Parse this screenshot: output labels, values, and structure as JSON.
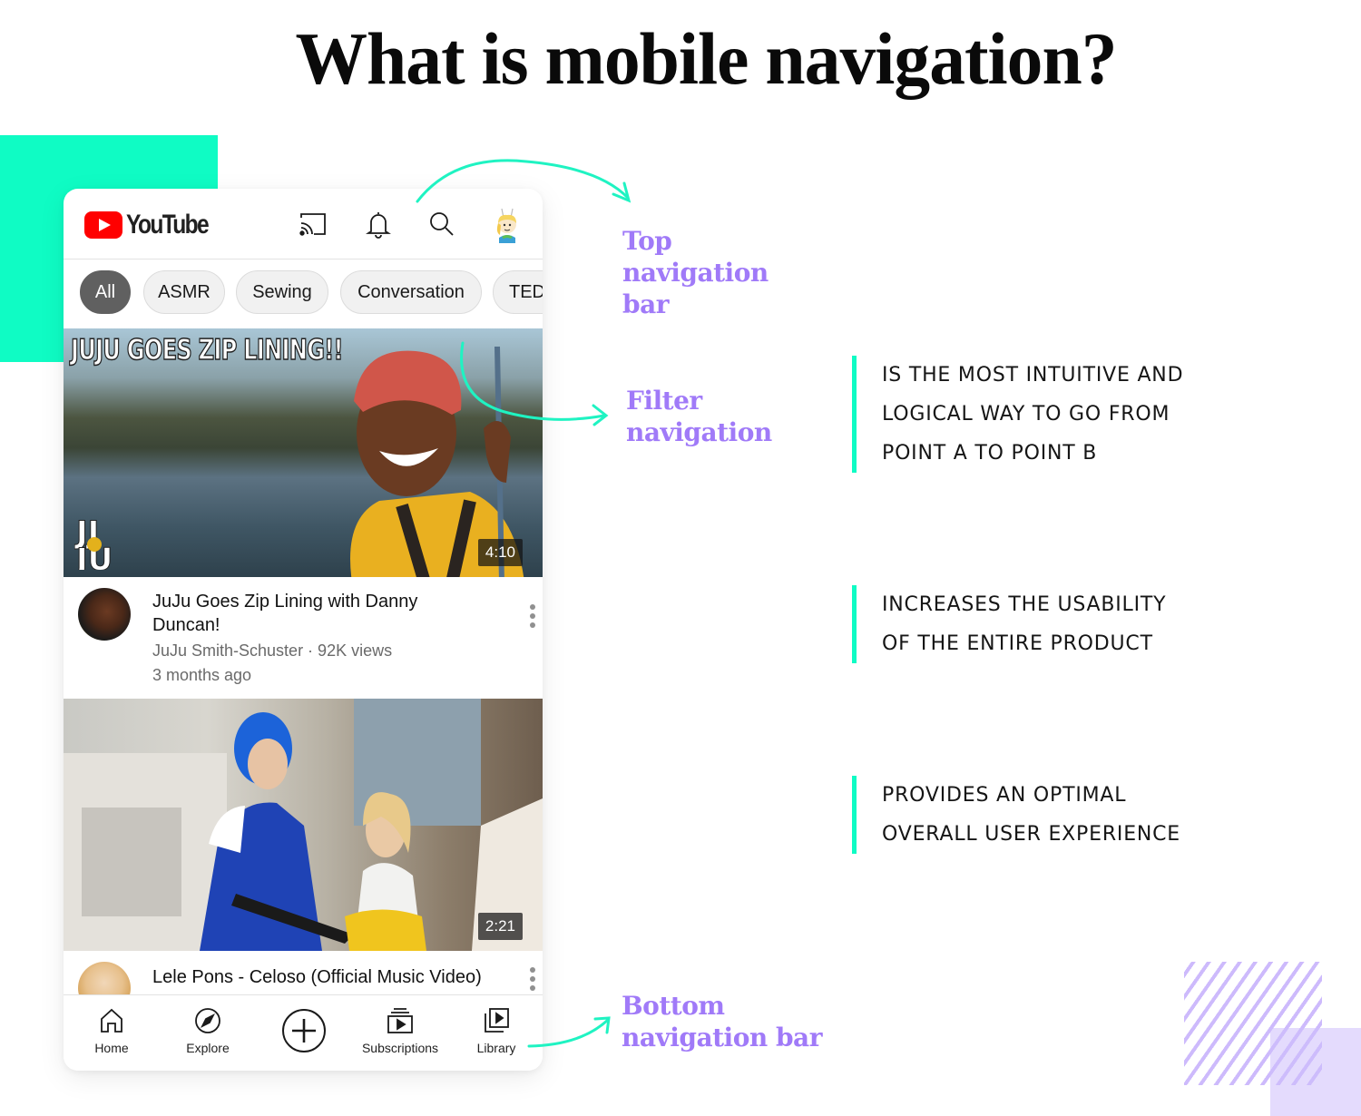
{
  "page": {
    "title": "What is mobile navigation?"
  },
  "app": {
    "brand": "YouTube",
    "top_bar": {
      "icons": [
        "cast-icon",
        "bell-icon",
        "search-icon",
        "avatar"
      ]
    },
    "filter_chips": [
      {
        "label": "All",
        "active": true
      },
      {
        "label": "ASMR",
        "active": false
      },
      {
        "label": "Sewing",
        "active": false
      },
      {
        "label": "Conversation",
        "active": false
      },
      {
        "label": "TED",
        "active": false
      }
    ],
    "videos": [
      {
        "thumbnail_overlay_text": "JUJU GOES ZIP LINING!!",
        "duration": "4:10",
        "title": "JuJu Goes Zip Lining with Danny Duncan!",
        "channel_line": "JuJu Smith-Schuster · 92K views",
        "age": "3 months ago"
      },
      {
        "duration": "2:21",
        "title": "Lele Pons - Celoso (Official Music Video)"
      }
    ],
    "bottom_nav": [
      {
        "label": "Home",
        "icon": "home-icon"
      },
      {
        "label": "Explore",
        "icon": "compass-icon"
      },
      {
        "label": "",
        "icon": "create-plus-icon"
      },
      {
        "label": "Subscriptions",
        "icon": "subscriptions-icon"
      },
      {
        "label": "Library",
        "icon": "library-icon"
      }
    ]
  },
  "callouts": {
    "top_nav": [
      "Top",
      "navigation",
      "bar"
    ],
    "filter_nav": [
      "Filter",
      "navigation"
    ],
    "bottom_nav": [
      "Bottom",
      "navigation bar"
    ]
  },
  "benefits": [
    [
      "IS THE MOST INTUITIVE AND",
      "LOGICAL WAY TO GO FROM",
      "POINT A TO POINT B"
    ],
    [
      "INCREASES THE USABILITY",
      "OF THE ENTIRE PRODUCT"
    ],
    [
      "PROVIDES AN OPTIMAL",
      "OVERALL USER EXPERIENCE"
    ]
  ],
  "colors": {
    "accent_teal": "#0ffcc4",
    "callout_purple": "#a07af8",
    "youtube_red": "#ff0000",
    "decor_lilac": "#cdbafc"
  }
}
